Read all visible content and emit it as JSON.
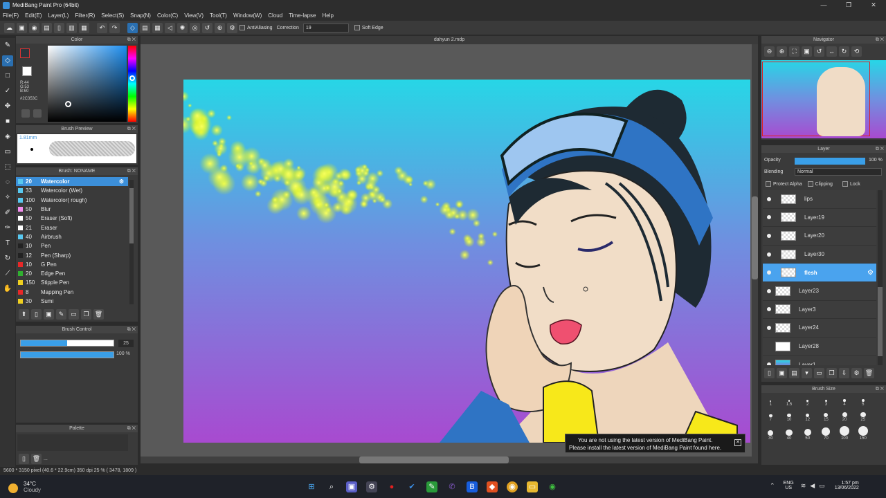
{
  "titlebar": {
    "title": "MediBang Paint Pro (64bit)",
    "min": "—",
    "max": "❐",
    "close": "✕"
  },
  "menu": [
    "File(F)",
    "Edit(E)",
    "Layer(L)",
    "Filter(R)",
    "Select(S)",
    "Snap(N)",
    "Color(C)",
    "View(V)",
    "Tool(T)",
    "Window(W)",
    "Cloud",
    "Time-lapse",
    "Help"
  ],
  "toolbar": {
    "antialias": "AntiAliasing",
    "correction_label": "Correction",
    "correction_value": "19",
    "soft_edge": "Soft Edge"
  },
  "color_panel": {
    "title": "Color",
    "r": "R:44",
    "g": "G:53",
    "b": "B:60",
    "hex": "#2C353C",
    "fg": "#2c353c"
  },
  "brush_preview": {
    "title": "Brush Preview",
    "size": "1.81mm"
  },
  "brush_panel": {
    "title": "Brush: NONAME",
    "items": [
      {
        "size": "20",
        "name": "Watercolor",
        "color": "#58c8f0",
        "selected": true
      },
      {
        "size": "33",
        "name": "Watercolor (Wet)",
        "color": "#58c8f0"
      },
      {
        "size": "100",
        "name": "Watercolor( rough)",
        "color": "#58c8f0"
      },
      {
        "size": "50",
        "name": "Blur",
        "color": "#f58ef0"
      },
      {
        "size": "50",
        "name": "Eraser (Soft)",
        "color": "#ffffff"
      },
      {
        "size": "21",
        "name": "Eraser",
        "color": "#ffffff"
      },
      {
        "size": "40",
        "name": "Airbrush",
        "color": "#58c8f0"
      },
      {
        "size": "10",
        "name": "Pen",
        "color": "#222222"
      },
      {
        "size": "12",
        "name": "Pen (Sharp)",
        "color": "#222222"
      },
      {
        "size": "10",
        "name": "G Pen",
        "color": "#e82828"
      },
      {
        "size": "20",
        "name": "Edge Pen",
        "color": "#30b030"
      },
      {
        "size": "150",
        "name": "Stipple Pen",
        "color": "#f0d020"
      },
      {
        "size": "8",
        "name": "Mapping Pen",
        "color": "#e82828"
      },
      {
        "size": "30",
        "name": "Sumi",
        "color": "#f0d020"
      }
    ]
  },
  "brush_control": {
    "title": "Brush Control",
    "size": "25",
    "opacity": "100 %",
    "size_fraction": 0.5,
    "opacity_fraction": 1.0
  },
  "palette": {
    "title": "Palette",
    "more": "..."
  },
  "document": {
    "tab": "dahyun 2.mdp"
  },
  "navigator": {
    "title": "Navigator"
  },
  "layer_panel": {
    "title": "Layer",
    "opacity_label": "Opacity",
    "opacity_value": "100 %",
    "blending_label": "Blending",
    "blending_value": "Normal",
    "protect_alpha": "Protect Alpha",
    "clipping": "Clipping",
    "lock": "Lock",
    "layers": [
      {
        "name": "lips",
        "indent": true,
        "visible": true
      },
      {
        "name": "Layer19",
        "indent": true,
        "visible": true
      },
      {
        "name": "Layer20",
        "indent": true,
        "visible": true
      },
      {
        "name": "Layer30",
        "indent": true,
        "visible": true
      },
      {
        "name": "flesh",
        "indent": true,
        "visible": true,
        "selected": true
      },
      {
        "name": "Layer23",
        "indent": false,
        "visible": true
      },
      {
        "name": "Layer3",
        "indent": false,
        "visible": true
      },
      {
        "name": "Layer24",
        "indent": false,
        "visible": true
      },
      {
        "name": "Layer28",
        "indent": false,
        "visible": false
      },
      {
        "name": "Layer1",
        "indent": false,
        "visible": true
      }
    ]
  },
  "brush_size": {
    "title": "Brush Size",
    "sizes": [
      "1",
      "1.5",
      "2",
      "3",
      "4",
      "5",
      "7",
      "10",
      "12",
      "15",
      "20",
      "25",
      "30",
      "40",
      "50",
      "70",
      "100",
      "150"
    ]
  },
  "notification": {
    "line1": "You are not using the latest version of MediBang Paint.",
    "line2": "Please install the latest version of MediBang Paint found here."
  },
  "status": {
    "text": "5600 * 3150 pixel   (40.6 * 22.9cm)   350 dpi   25 %   ( 3478, 1809 )"
  },
  "taskbar": {
    "temp": "34°C",
    "weather": "Cloudy",
    "lang1": "ENG",
    "lang2": "US",
    "time": "1:57 pm",
    "date": "13/06/2022"
  }
}
